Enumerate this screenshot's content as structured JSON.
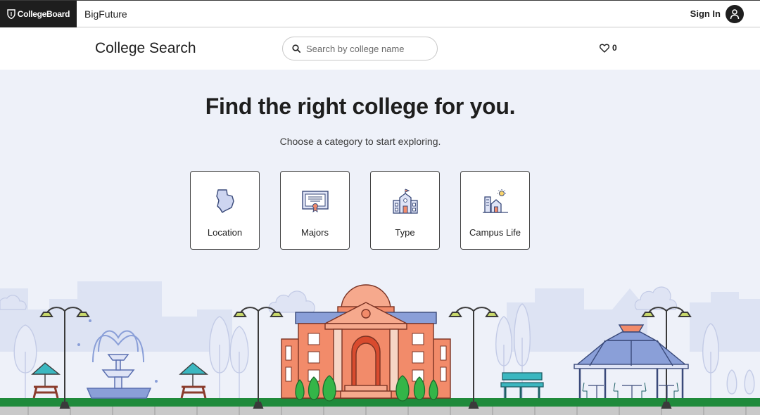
{
  "topnav": {
    "brand": "CollegeBoard",
    "product": "BigFuture",
    "signin_label": "Sign In"
  },
  "header": {
    "title": "College Search",
    "search_placeholder": "Search by college name",
    "favorites_count": "0"
  },
  "hero": {
    "title": "Find the right college for you.",
    "subtitle": "Choose a category to start exploring."
  },
  "categories": [
    {
      "label": "Location",
      "icon": "map-state-icon"
    },
    {
      "label": "Majors",
      "icon": "diploma-icon"
    },
    {
      "label": "Type",
      "icon": "school-building-icon"
    },
    {
      "label": "Campus Life",
      "icon": "campus-life-icon"
    }
  ],
  "colors": {
    "brand_dark": "#1e1e1e",
    "background": "#eef1f9",
    "grass": "#1f8a3b",
    "building": "#f28b6a",
    "roof": "#6a8ad6"
  }
}
